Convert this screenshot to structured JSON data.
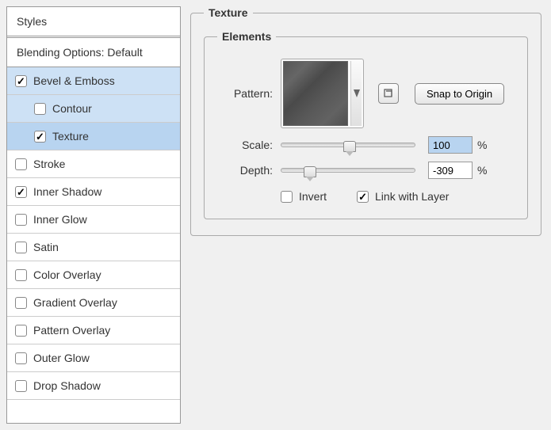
{
  "sidebar": {
    "header": "Styles",
    "subheader": "Blending Options: Default",
    "items": [
      {
        "label": "Bevel & Emboss",
        "checked": true,
        "selected": true,
        "indent": false
      },
      {
        "label": "Contour",
        "checked": false,
        "selected": true,
        "indent": true
      },
      {
        "label": "Texture",
        "checked": true,
        "selected": true,
        "indent": true,
        "active": true
      },
      {
        "label": "Stroke",
        "checked": false,
        "selected": false,
        "indent": false
      },
      {
        "label": "Inner Shadow",
        "checked": true,
        "selected": false,
        "indent": false
      },
      {
        "label": "Inner Glow",
        "checked": false,
        "selected": false,
        "indent": false
      },
      {
        "label": "Satin",
        "checked": false,
        "selected": false,
        "indent": false
      },
      {
        "label": "Color Overlay",
        "checked": false,
        "selected": false,
        "indent": false
      },
      {
        "label": "Gradient Overlay",
        "checked": false,
        "selected": false,
        "indent": false
      },
      {
        "label": "Pattern Overlay",
        "checked": false,
        "selected": false,
        "indent": false
      },
      {
        "label": "Outer Glow",
        "checked": false,
        "selected": false,
        "indent": false
      },
      {
        "label": "Drop Shadow",
        "checked": false,
        "selected": false,
        "indent": false
      }
    ]
  },
  "panel": {
    "outer_title": "Texture",
    "inner_title": "Elements",
    "pattern_label": "Pattern:",
    "snap_label": "Snap to Origin",
    "scale_label": "Scale:",
    "scale_value": "100",
    "scale_unit": "%",
    "depth_label": "Depth:",
    "depth_value": "-309",
    "depth_unit": "%",
    "invert_label": "Invert",
    "invert_checked": false,
    "link_label": "Link with Layer",
    "link_checked": true
  }
}
